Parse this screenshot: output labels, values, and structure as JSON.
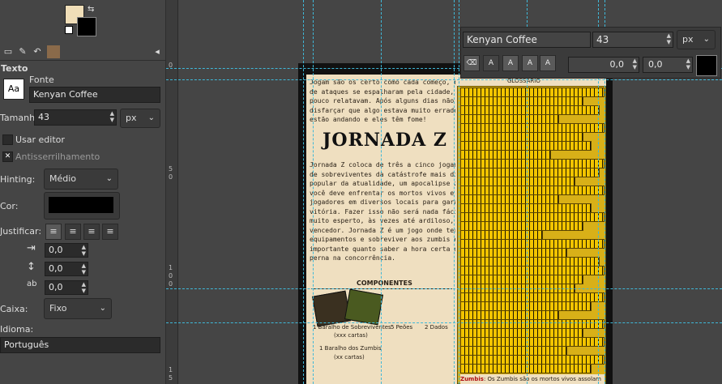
{
  "panel": {
    "tool_title": "Texto",
    "font_label": "Fonte",
    "font_value": "Kenyan Coffee",
    "size_label": "Tamanho:",
    "size_value": "43",
    "unit": "px",
    "use_editor": "Usar editor",
    "antialias": "Antisserrilhamento",
    "hinting_label": "Hinting:",
    "hinting_value": "Médio",
    "color_label": "Cor:",
    "color_value": "#000000",
    "justify_label": "Justificar:",
    "indent_value": "0,0",
    "line_spacing_value": "0,0",
    "letter_spacing_value": "0,0",
    "box_label": "Caixa:",
    "box_value": "Fixo",
    "language_label": "Idioma:",
    "language_value": "Português",
    "fg_color": "#f0deb8",
    "bg_color": "#000000"
  },
  "floating": {
    "font_value": "Kenyan Coffee",
    "size_value": "43",
    "unit": "px",
    "baseline_value": "0,0",
    "kerning_value": "0,0",
    "color_value": "#000000"
  },
  "canvas": {
    "guide_color": "#3fb8d8",
    "ruler_labels": [
      "0",
      "5",
      "0",
      "1",
      "0",
      "0",
      "1",
      "5"
    ],
    "doc": {
      "intro": "Jogam são os certo como cada começo, notícias\nde ataques se espalharam pela cidade, os jornais\npouco relatavam. Após alguns dias não dava mais de\ndisfarçar que algo estava muito errado... Os mortos\nestão andando e eles têm fome!",
      "logo": "JORNADA Z",
      "body": "Jornada Z coloca de três a cinco jogadores no papel\nde sobreviventes da catástrofe mais divertida e\npopular da atualidade, um apocalipse zumbi. No jogo\nvocê deve enfrentar os mortos vivos e os outros\njogadores em diversos locais para garantir sua\nvitória. Fazer isso não será nada fácil, é preciso ser\nmuito esperto, às vezes até ardiloso, para se tornar o\nvencedor. Jornada Z é um jogo onde ter bons\nequipamentos e sobreviver aos zumbis é tão\nimportante quanto saber a hora certa de passar a\nperna na concorrência.",
      "components_heading": "COMPONENTES",
      "comp1": "1 Baralho de Sobreviventes",
      "comp1_count": "(xxx cartas)",
      "comp2": "5 Peões",
      "comp3": "2 Dados",
      "comp4": "1 Baralho dos Zumbis",
      "comp4_count": "(xx cartas)",
      "glossary_heading": "GLOSSÁRIO",
      "zumbis_term": "Zumbis",
      "zumbis_def": ": Os Zumbis são os mortos vivos assolam"
    }
  }
}
